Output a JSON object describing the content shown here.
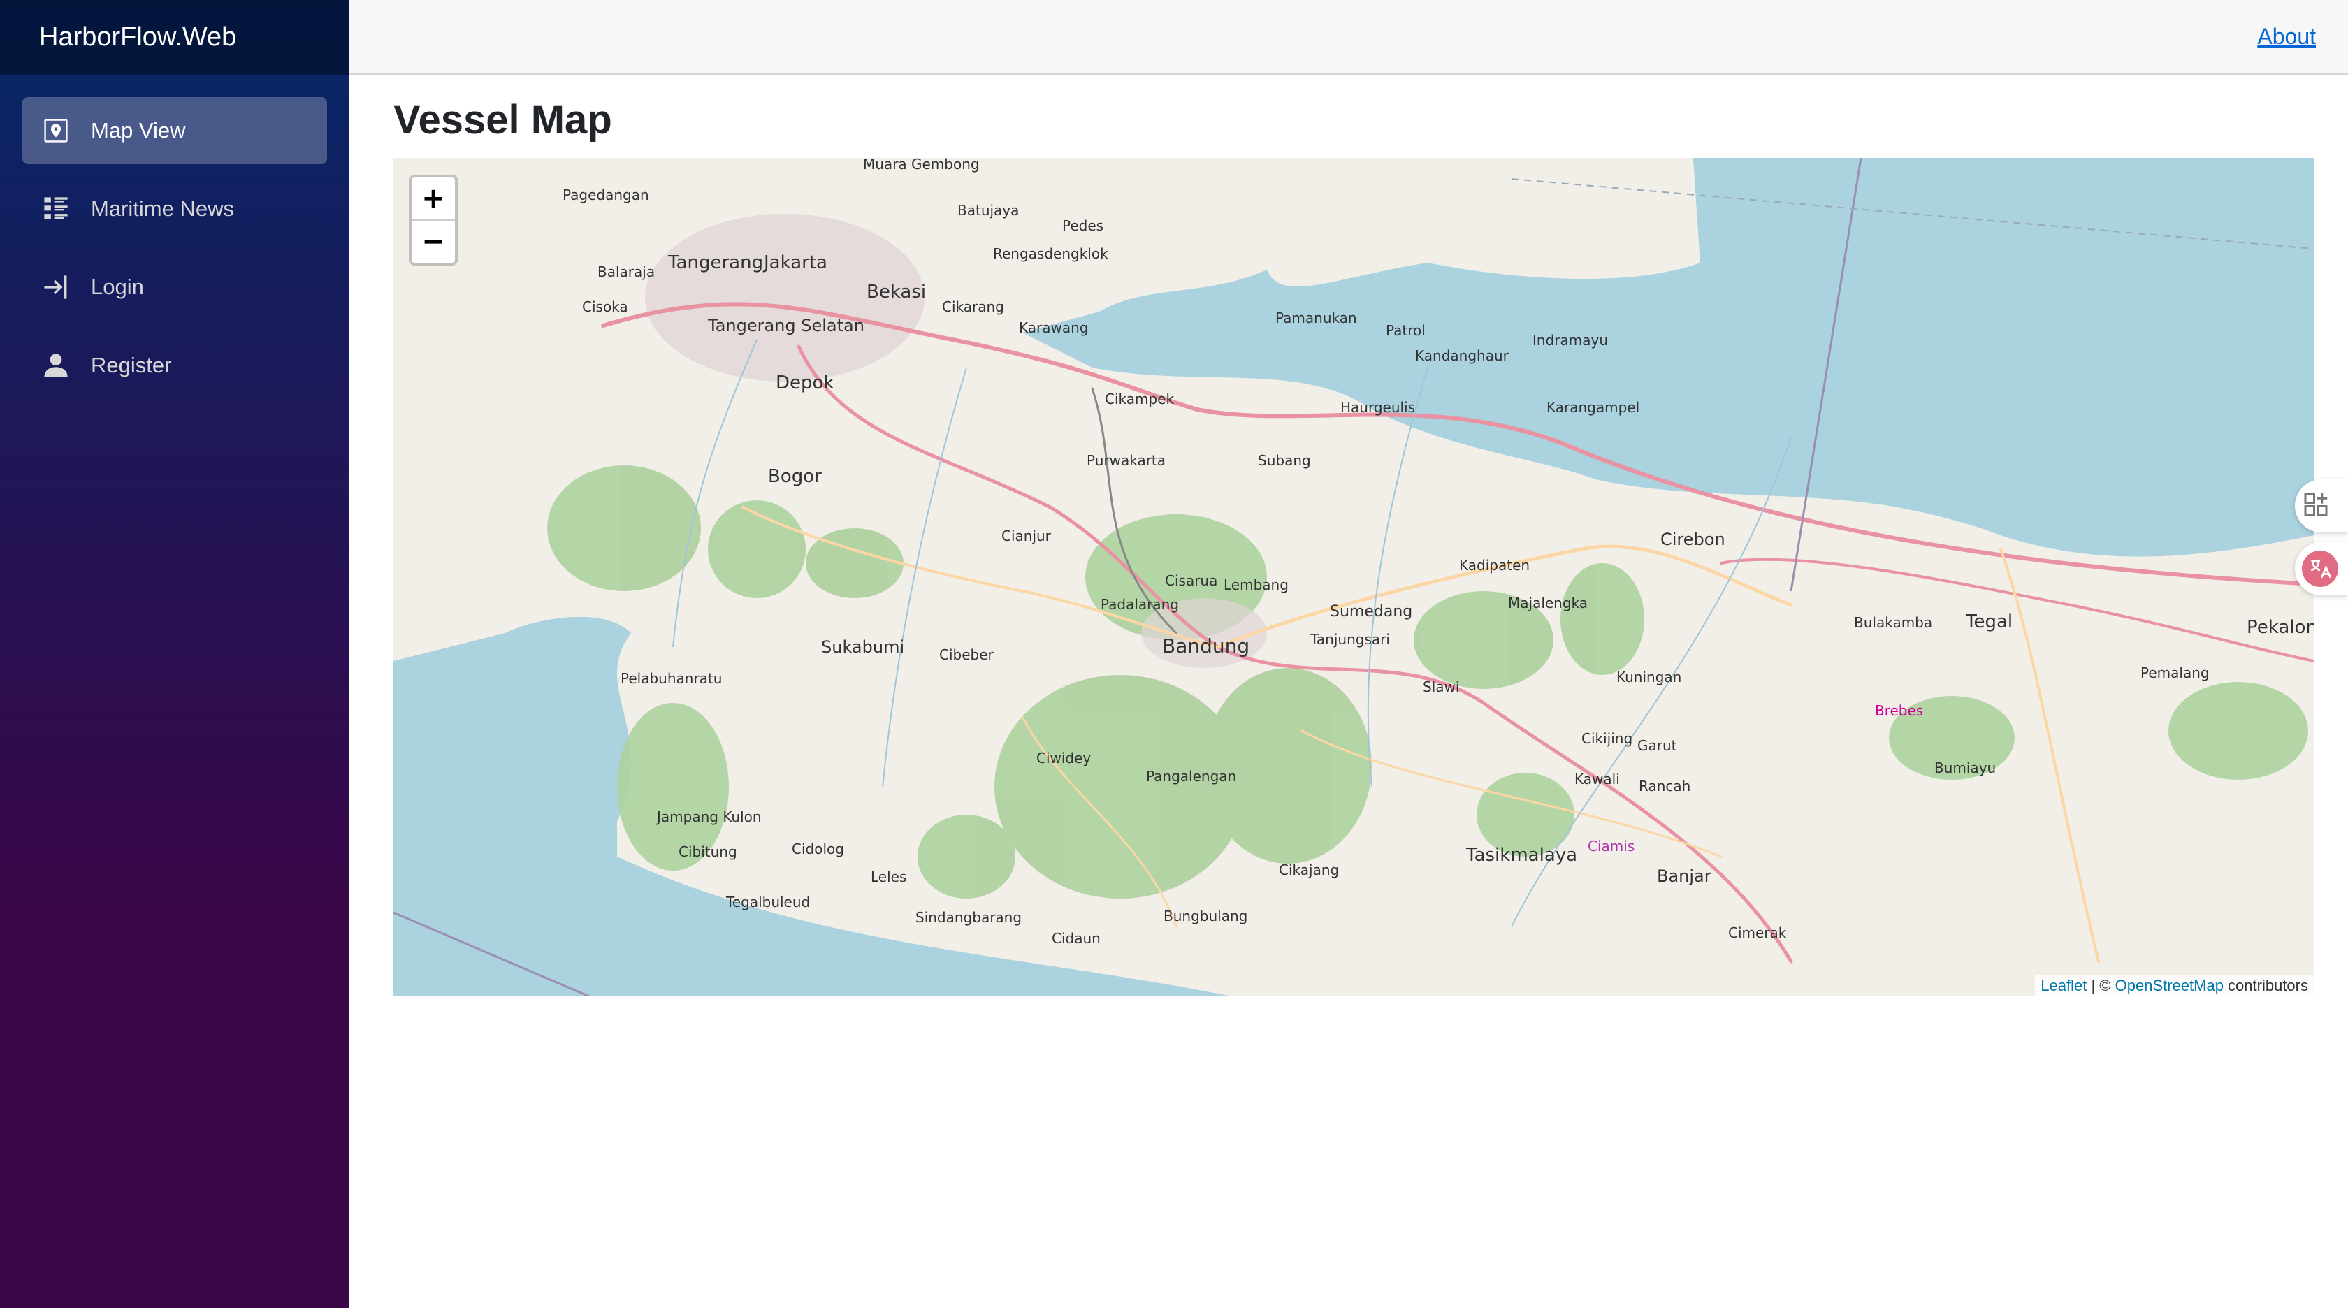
{
  "app": {
    "brand": "HarborFlow.Web"
  },
  "sidebar": {
    "items": [
      {
        "label": "Map View",
        "icon": "map-icon",
        "active": true
      },
      {
        "label": "Maritime News",
        "icon": "list-icon",
        "active": false
      },
      {
        "label": "Login",
        "icon": "login-icon",
        "active": false
      },
      {
        "label": "Register",
        "icon": "person-icon",
        "active": false
      }
    ]
  },
  "top_row": {
    "about": "About"
  },
  "main": {
    "title": "Vessel Map"
  },
  "map": {
    "zoom_in": "+",
    "zoom_out": "−",
    "attribution": {
      "leaflet": "Leaflet",
      "separator": " | © ",
      "osm": "OpenStreetMap",
      "suffix": " contributors"
    },
    "cities": [
      "Jakarta",
      "Tangerang",
      "Tangerang Selatan",
      "Bekasi",
      "Depok",
      "Bogor",
      "Cikarang",
      "Karawang",
      "Pamanukan",
      "Patrol",
      "Indramayu",
      "Subang",
      "Purwakarta",
      "Cirebon",
      "Sumedang",
      "Bandung",
      "Tanjungsari",
      "Sukabumi",
      "Cibeber",
      "Majalengka",
      "Kuningan",
      "Tegal",
      "Pekalongan",
      "Brebes",
      "Garut",
      "Tasikmalaya",
      "Banjar",
      "Ciamis",
      "Cianjur",
      "Pelabuhanratu",
      "Pangalengan",
      "Cisarua",
      "Padalarang",
      "Lembang",
      "Bulakamba",
      "Slawi",
      "Kadipaten",
      "Bumiayu",
      "Cikampek",
      "Rengasdengklok",
      "Pagedangan",
      "Cisoka",
      "Balaraja",
      "Muara Gembong",
      "Batujaya",
      "Pedes",
      "Sindangbarang",
      "Cidaun",
      "Tegalbuleud",
      "Cikajang",
      "Bungbulang",
      "Karangampel",
      "Haurgeulis",
      "Kandanghaur",
      "Pemalang",
      "Jampang Kulon",
      "Cibitung",
      "Cidolog",
      "Leles",
      "Rancah",
      "Cimerak",
      "Kawali",
      "Cikijing",
      "Ciwidey"
    ]
  },
  "widgets": {
    "one_icon": "grid-plus-icon",
    "two_icon": "translate-icon"
  },
  "colors": {
    "sidebar_top": "#052767",
    "sidebar_bottom": "#3a0647",
    "sea": "#aad3df",
    "land": "#f2efe9",
    "forest": "#add19e",
    "link": "#0366d6"
  }
}
